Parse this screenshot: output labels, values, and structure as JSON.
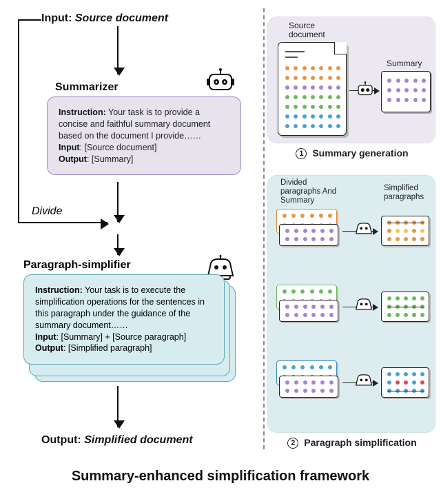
{
  "title": "Summary-enhanced simplification  framework",
  "left": {
    "input_word": "Input:",
    "input_val": "Source document",
    "summarizer": "Summarizer",
    "divide": "Divide",
    "paragraph_simplifier": "Paragraph-simplifier",
    "output_word": "Output:",
    "output_val": "Simplified document"
  },
  "sum_card": {
    "instr_label": "Instruction:",
    "instr_text": "Your task is to provide a concise and faithful summary document based on the document I provide……",
    "input_label": "Input",
    "input_text": "[Source document]",
    "output_label": "Output",
    "output_text": "[Summary]"
  },
  "para_card": {
    "instr_label": "Instruction:",
    "instr_text": "Your task is to execute the simplification operations for the sentences in this paragraph under the guidance of the summary document……",
    "input_label": "Input",
    "input_text": "[Summary] + [Source paragraph]",
    "output_label": "Output",
    "output_text": "[Simplified paragraph]"
  },
  "right": {
    "top": {
      "src_doc": "Source document",
      "summary": "Summary",
      "caption_num": "1",
      "caption": "Summary generation"
    },
    "bot": {
      "left_lbl": "Divided paragraphs And Summary",
      "right_lbl": "Simplified paragraphs",
      "caption_num": "2",
      "caption": "Paragraph simplification"
    }
  },
  "chart_data": {
    "type": "flowchart",
    "title": "Summary-enhanced simplification framework",
    "nodes": [
      {
        "id": "input",
        "label": "Input: Source document"
      },
      {
        "id": "summarizer",
        "label": "Summarizer",
        "prompt": "Your task is to provide a concise and faithful summary document based on the document I provide……",
        "io": {
          "input": "[Source document]",
          "output": "[Summary]"
        }
      },
      {
        "id": "divide",
        "label": "Divide"
      },
      {
        "id": "paragraph_simplifier",
        "label": "Paragraph-simplifier",
        "prompt": "Your task is to execute the simplification operations for the sentences in this paragraph under the guidance of the summary document……",
        "io": {
          "input": "[Summary] + [Source paragraph]",
          "output": "[Simplified paragraph]"
        }
      },
      {
        "id": "output",
        "label": "Output: Simplified document"
      }
    ],
    "edges": [
      [
        "input",
        "summarizer"
      ],
      [
        "input",
        "divide"
      ],
      [
        "summarizer",
        "divide"
      ],
      [
        "divide",
        "paragraph_simplifier"
      ],
      [
        "paragraph_simplifier",
        "output"
      ]
    ],
    "right_panels": [
      {
        "step": 1,
        "label": "Summary generation",
        "from": "Source document",
        "to": "Summary"
      },
      {
        "step": 2,
        "label": "Paragraph simplification",
        "from": "Divided paragraphs And Summary",
        "to": "Simplified paragraphs",
        "count": 3
      }
    ]
  }
}
